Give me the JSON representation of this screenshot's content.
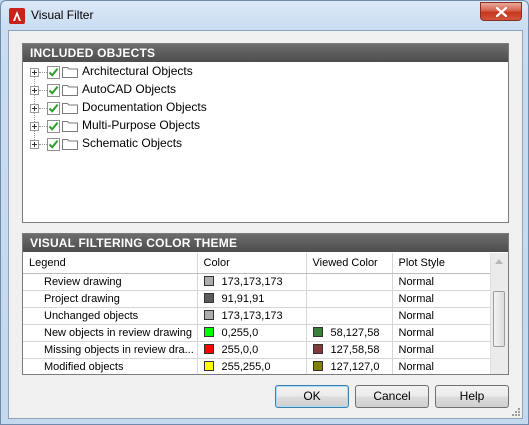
{
  "window": {
    "title": "Visual Filter"
  },
  "included": {
    "header": "INCLUDED OBJECTS",
    "items": [
      {
        "label": "Architectural Objects",
        "checked": true
      },
      {
        "label": "AutoCAD Objects",
        "checked": true
      },
      {
        "label": "Documentation Objects",
        "checked": true
      },
      {
        "label": "Multi-Purpose Objects",
        "checked": true
      },
      {
        "label": "Schematic Objects",
        "checked": true
      }
    ]
  },
  "theme": {
    "header": "VISUAL FILTERING COLOR THEME",
    "columns": [
      "Legend",
      "Color",
      "Viewed Color",
      "Plot Style"
    ],
    "rows": [
      {
        "legend": "Review drawing",
        "color": "173,173,173",
        "color_hex": "#adadad",
        "viewed": "",
        "viewed_hex": "",
        "plot": "Normal"
      },
      {
        "legend": "Project drawing",
        "color": "91,91,91",
        "color_hex": "#5b5b5b",
        "viewed": "",
        "viewed_hex": "",
        "plot": "Normal"
      },
      {
        "legend": "Unchanged objects",
        "color": "173,173,173",
        "color_hex": "#adadad",
        "viewed": "",
        "viewed_hex": "",
        "plot": "Normal"
      },
      {
        "legend": "New objects in review drawing",
        "color": "0,255,0",
        "color_hex": "#00ff00",
        "viewed": "58,127,58",
        "viewed_hex": "#3a7f3a",
        "plot": "Normal"
      },
      {
        "legend": "Missing objects in review dra...",
        "color": "255,0,0",
        "color_hex": "#ff0000",
        "viewed": "127,58,58",
        "viewed_hex": "#7f3a3a",
        "plot": "Normal"
      },
      {
        "legend": "Modified objects",
        "color": "255,255,0",
        "color_hex": "#ffff00",
        "viewed": "127,127,0",
        "viewed_hex": "#7f7f00",
        "plot": "Normal"
      }
    ]
  },
  "buttons": {
    "ok": "OK",
    "cancel": "Cancel",
    "help": "Help"
  },
  "colors": {
    "header_bg": "#5a5a5a",
    "check_green": "#2a9d2a"
  }
}
